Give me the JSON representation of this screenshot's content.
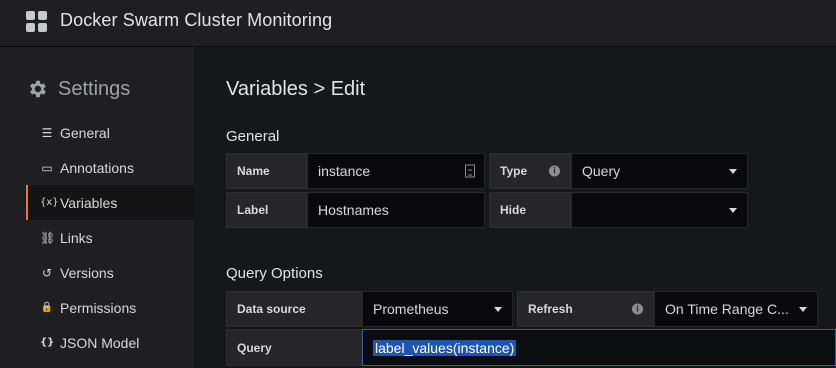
{
  "header": {
    "title": "Docker Swarm Cluster Monitoring",
    "logo_icon": "grid-icon"
  },
  "sidebar": {
    "heading": "Settings",
    "items": [
      {
        "label": "General",
        "icon": "sliders-icon",
        "glyph": "☰"
      },
      {
        "label": "Annotations",
        "icon": "comment-icon",
        "glyph": "▭"
      },
      {
        "label": "Variables",
        "icon": "variable-icon",
        "glyph": "{x}",
        "active": true
      },
      {
        "label": "Links",
        "icon": "link-icon",
        "glyph": "⛓"
      },
      {
        "label": "Versions",
        "icon": "history-icon",
        "glyph": "↺"
      },
      {
        "label": "Permissions",
        "icon": "lock-icon",
        "glyph": "🔒"
      },
      {
        "label": "JSON Model",
        "icon": "json-icon",
        "glyph": "{}"
      }
    ]
  },
  "page": {
    "title": "Variables > Edit"
  },
  "general": {
    "title": "General",
    "name_label": "Name",
    "name_value": "instance",
    "type_label": "Type",
    "type_value": "Query",
    "label_label": "Label",
    "label_value": "Hostnames",
    "hide_label": "Hide",
    "hide_value": ""
  },
  "query_options": {
    "title": "Query Options",
    "datasource_label": "Data source",
    "datasource_value": "Prometheus",
    "refresh_label": "Refresh",
    "refresh_value": "On Time Range C...",
    "query_label": "Query",
    "query_value": "label_values(instance)"
  },
  "colors": {
    "accent_active": "#eb7b18",
    "focus": "#1f60c4",
    "selection": "#1f54b4"
  }
}
